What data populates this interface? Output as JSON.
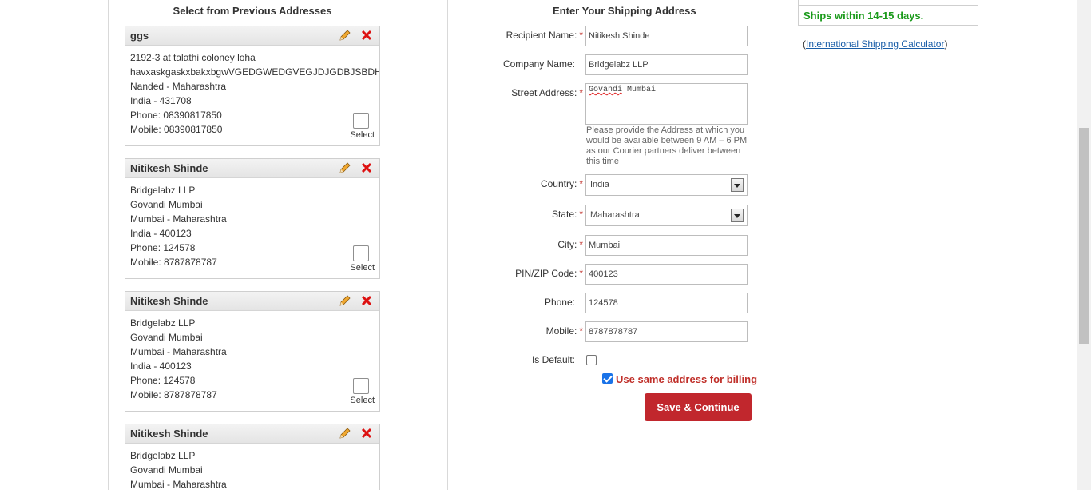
{
  "left": {
    "title": "Select from Previous Addresses",
    "select_label": "Select",
    "cards": [
      {
        "name": "ggs",
        "lines": [
          "2192-3 at talathi coloney loha",
          "havxaskgaskxbakxbgwVGEDGWEDGVEGJDJGDBJSBDHSNDHBSDJSDJB",
          "Nanded - Maharashtra",
          "India - 431708",
          "Phone: 08390817850",
          "Mobile: 08390817850"
        ]
      },
      {
        "name": "Nitikesh Shinde",
        "lines": [
          "Bridgelabz LLP",
          "Govandi Mumbai",
          "Mumbai - Maharashtra",
          "India - 400123",
          "Phone: 124578",
          "Mobile: 8787878787"
        ]
      },
      {
        "name": "Nitikesh Shinde",
        "lines": [
          "Bridgelabz LLP",
          "Govandi Mumbai",
          "Mumbai - Maharashtra",
          "India - 400123",
          "Phone: 124578",
          "Mobile: 8787878787"
        ]
      },
      {
        "name": "Nitikesh Shinde",
        "lines": [
          "Bridgelabz LLP",
          "Govandi Mumbai",
          "Mumbai - Maharashtra"
        ]
      }
    ]
  },
  "form": {
    "title": "Enter Your Shipping Address",
    "recipient_label": "Recipient Name:",
    "recipient_value": "Nitikesh Shinde",
    "company_label": "Company Name:",
    "company_value": "Bridgelabz LLP",
    "street_label": "Street Address:",
    "street_value_a": "Govandi",
    "street_value_b": " Mumbai",
    "street_hint": "Please provide the Address at which you would be available between 9 AM – 6 PM as our Courier partners deliver between this time",
    "country_label": "Country:",
    "country_value": "India",
    "state_label": "State:",
    "state_value": "Maharashtra",
    "city_label": "City:",
    "city_value": "Mumbai",
    "pin_label": "PIN/ZIP Code:",
    "pin_value": "400123",
    "phone_label": "Phone:",
    "phone_value": "124578",
    "mobile_label": "Mobile:",
    "mobile_value": "8787878787",
    "default_label": "Is Default:",
    "billing_label": "Use same address for billing",
    "save_label": "Save & Continue",
    "required_mark": "*"
  },
  "right": {
    "ship_text": "Ships within 14-15 days.",
    "calc_open": "(",
    "calc_link": "International Shipping Calculator",
    "calc_close": ")"
  },
  "colors": {
    "accent_red": "#c1272d",
    "ship_green": "#1a9a1a",
    "link_blue": "#1a5ea8"
  }
}
